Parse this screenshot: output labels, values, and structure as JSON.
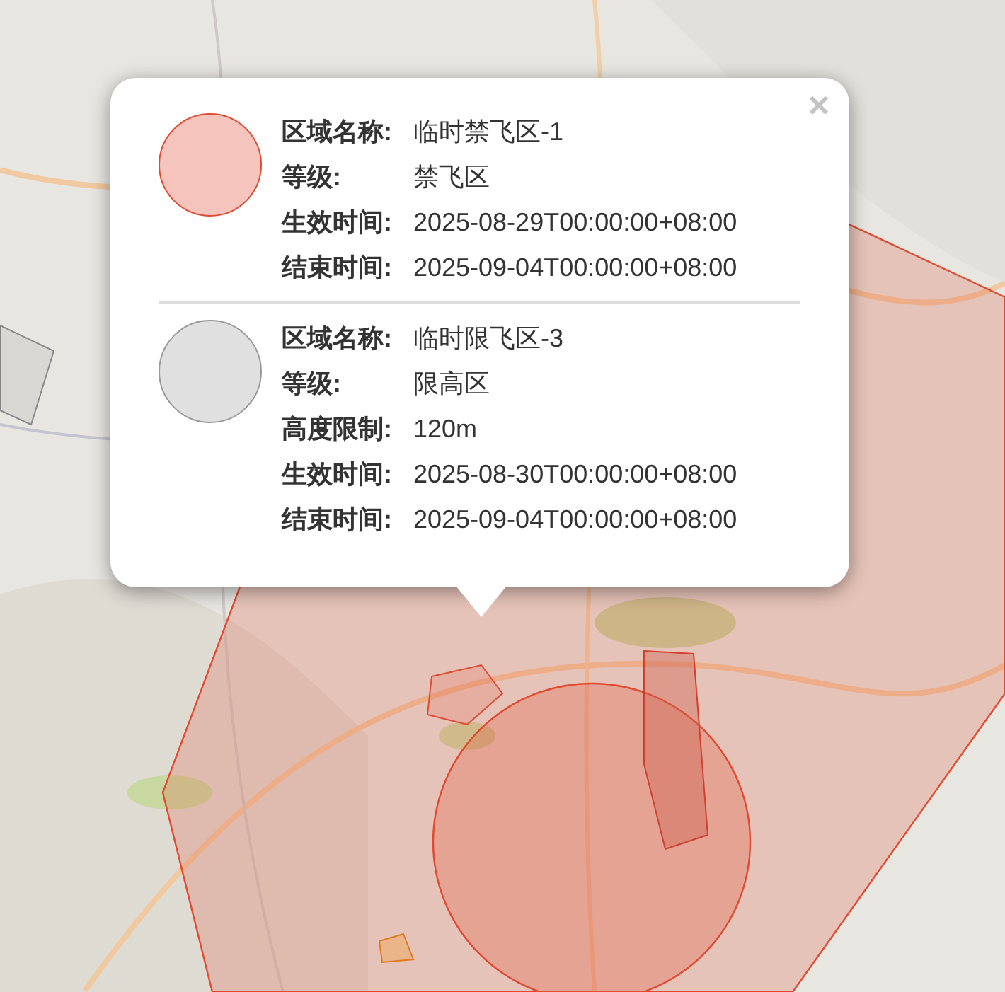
{
  "popup": {
    "close": "×",
    "zones": [
      {
        "kind": "no_fly",
        "color": "#f4c4bd",
        "fields": [
          {
            "label": "区域名称:",
            "value": "临时禁飞区-1"
          },
          {
            "label": "等级:",
            "value": "禁飞区"
          },
          {
            "label": "生效时间:",
            "value": "2025-08-29T00:00:00+08:00"
          },
          {
            "label": "结束时间:",
            "value": "2025-09-04T00:00:00+08:00"
          }
        ]
      },
      {
        "kind": "height_limit",
        "color": "#e0e0e0",
        "fields": [
          {
            "label": "区域名称:",
            "value": "临时限飞区-3"
          },
          {
            "label": "等级:",
            "value": "限高区"
          },
          {
            "label": "高度限制:",
            "value": "120m"
          },
          {
            "label": "生效时间:",
            "value": "2025-08-30T00:00:00+08:00"
          },
          {
            "label": "结束时间:",
            "value": "2025-09-04T00:00:00+08:00"
          }
        ]
      }
    ]
  }
}
